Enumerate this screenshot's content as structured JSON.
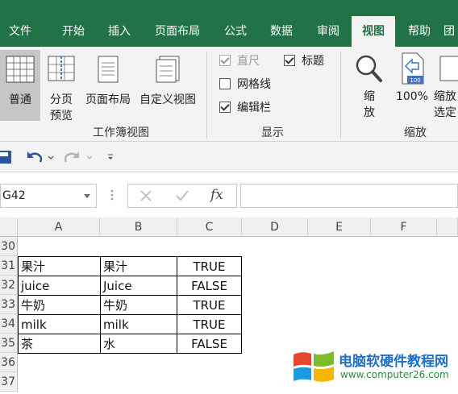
{
  "ribbon_tabs": [
    "文件",
    "开始",
    "插入",
    "页面布局",
    "公式",
    "数据",
    "审阅",
    "视图",
    "帮助",
    "团"
  ],
  "active_tab": "视图",
  "workbook_views": {
    "normal": "普通",
    "page_break_line1": "分页",
    "page_break_line2": "预览",
    "page_layout": "页面布局",
    "custom_view": "自定义视图",
    "group_label": "工作簿视图"
  },
  "show": {
    "ruler": "直尺",
    "gridlines": "网格线",
    "formula_bar": "编辑栏",
    "headings": "标题",
    "group_label": "显示",
    "ruler_checked": true,
    "gridlines_checked": false,
    "formula_bar_checked": true,
    "headings_checked": true
  },
  "zoom": {
    "zoom_line1": "缩",
    "zoom_line2": "放",
    "zoom_100": "100%",
    "zoom_selection_line1": "缩放",
    "zoom_selection_line2": "选定",
    "group_label": "缩放",
    "icon_badge": "100"
  },
  "formula_bar": {
    "name_box": "G42",
    "fx": "fx",
    "value": ""
  },
  "columns": [
    "A",
    "B",
    "C",
    "D",
    "E",
    "F"
  ],
  "rows": [
    "30",
    "31",
    "32",
    "33",
    "34",
    "35",
    "36",
    "37"
  ],
  "table": [
    {
      "row": "31",
      "a": "果汁",
      "b": "果汁",
      "c": "TRUE"
    },
    {
      "row": "32",
      "a": "juice",
      "b": "Juice",
      "c": "FALSE"
    },
    {
      "row": "33",
      "a": "牛奶",
      "b": "牛奶",
      "c": "TRUE"
    },
    {
      "row": "34",
      "a": "milk",
      "b": "milk",
      "c": "TRUE"
    },
    {
      "row": "35",
      "a": "茶",
      "b": "水",
      "c": "FALSE"
    }
  ],
  "watermark": {
    "title": "电脑软硬件教程网",
    "url": "www.computer26.com"
  },
  "colors": {
    "ribbon_green": "#217346",
    "ribbon_bg": "#f3f3f3"
  }
}
